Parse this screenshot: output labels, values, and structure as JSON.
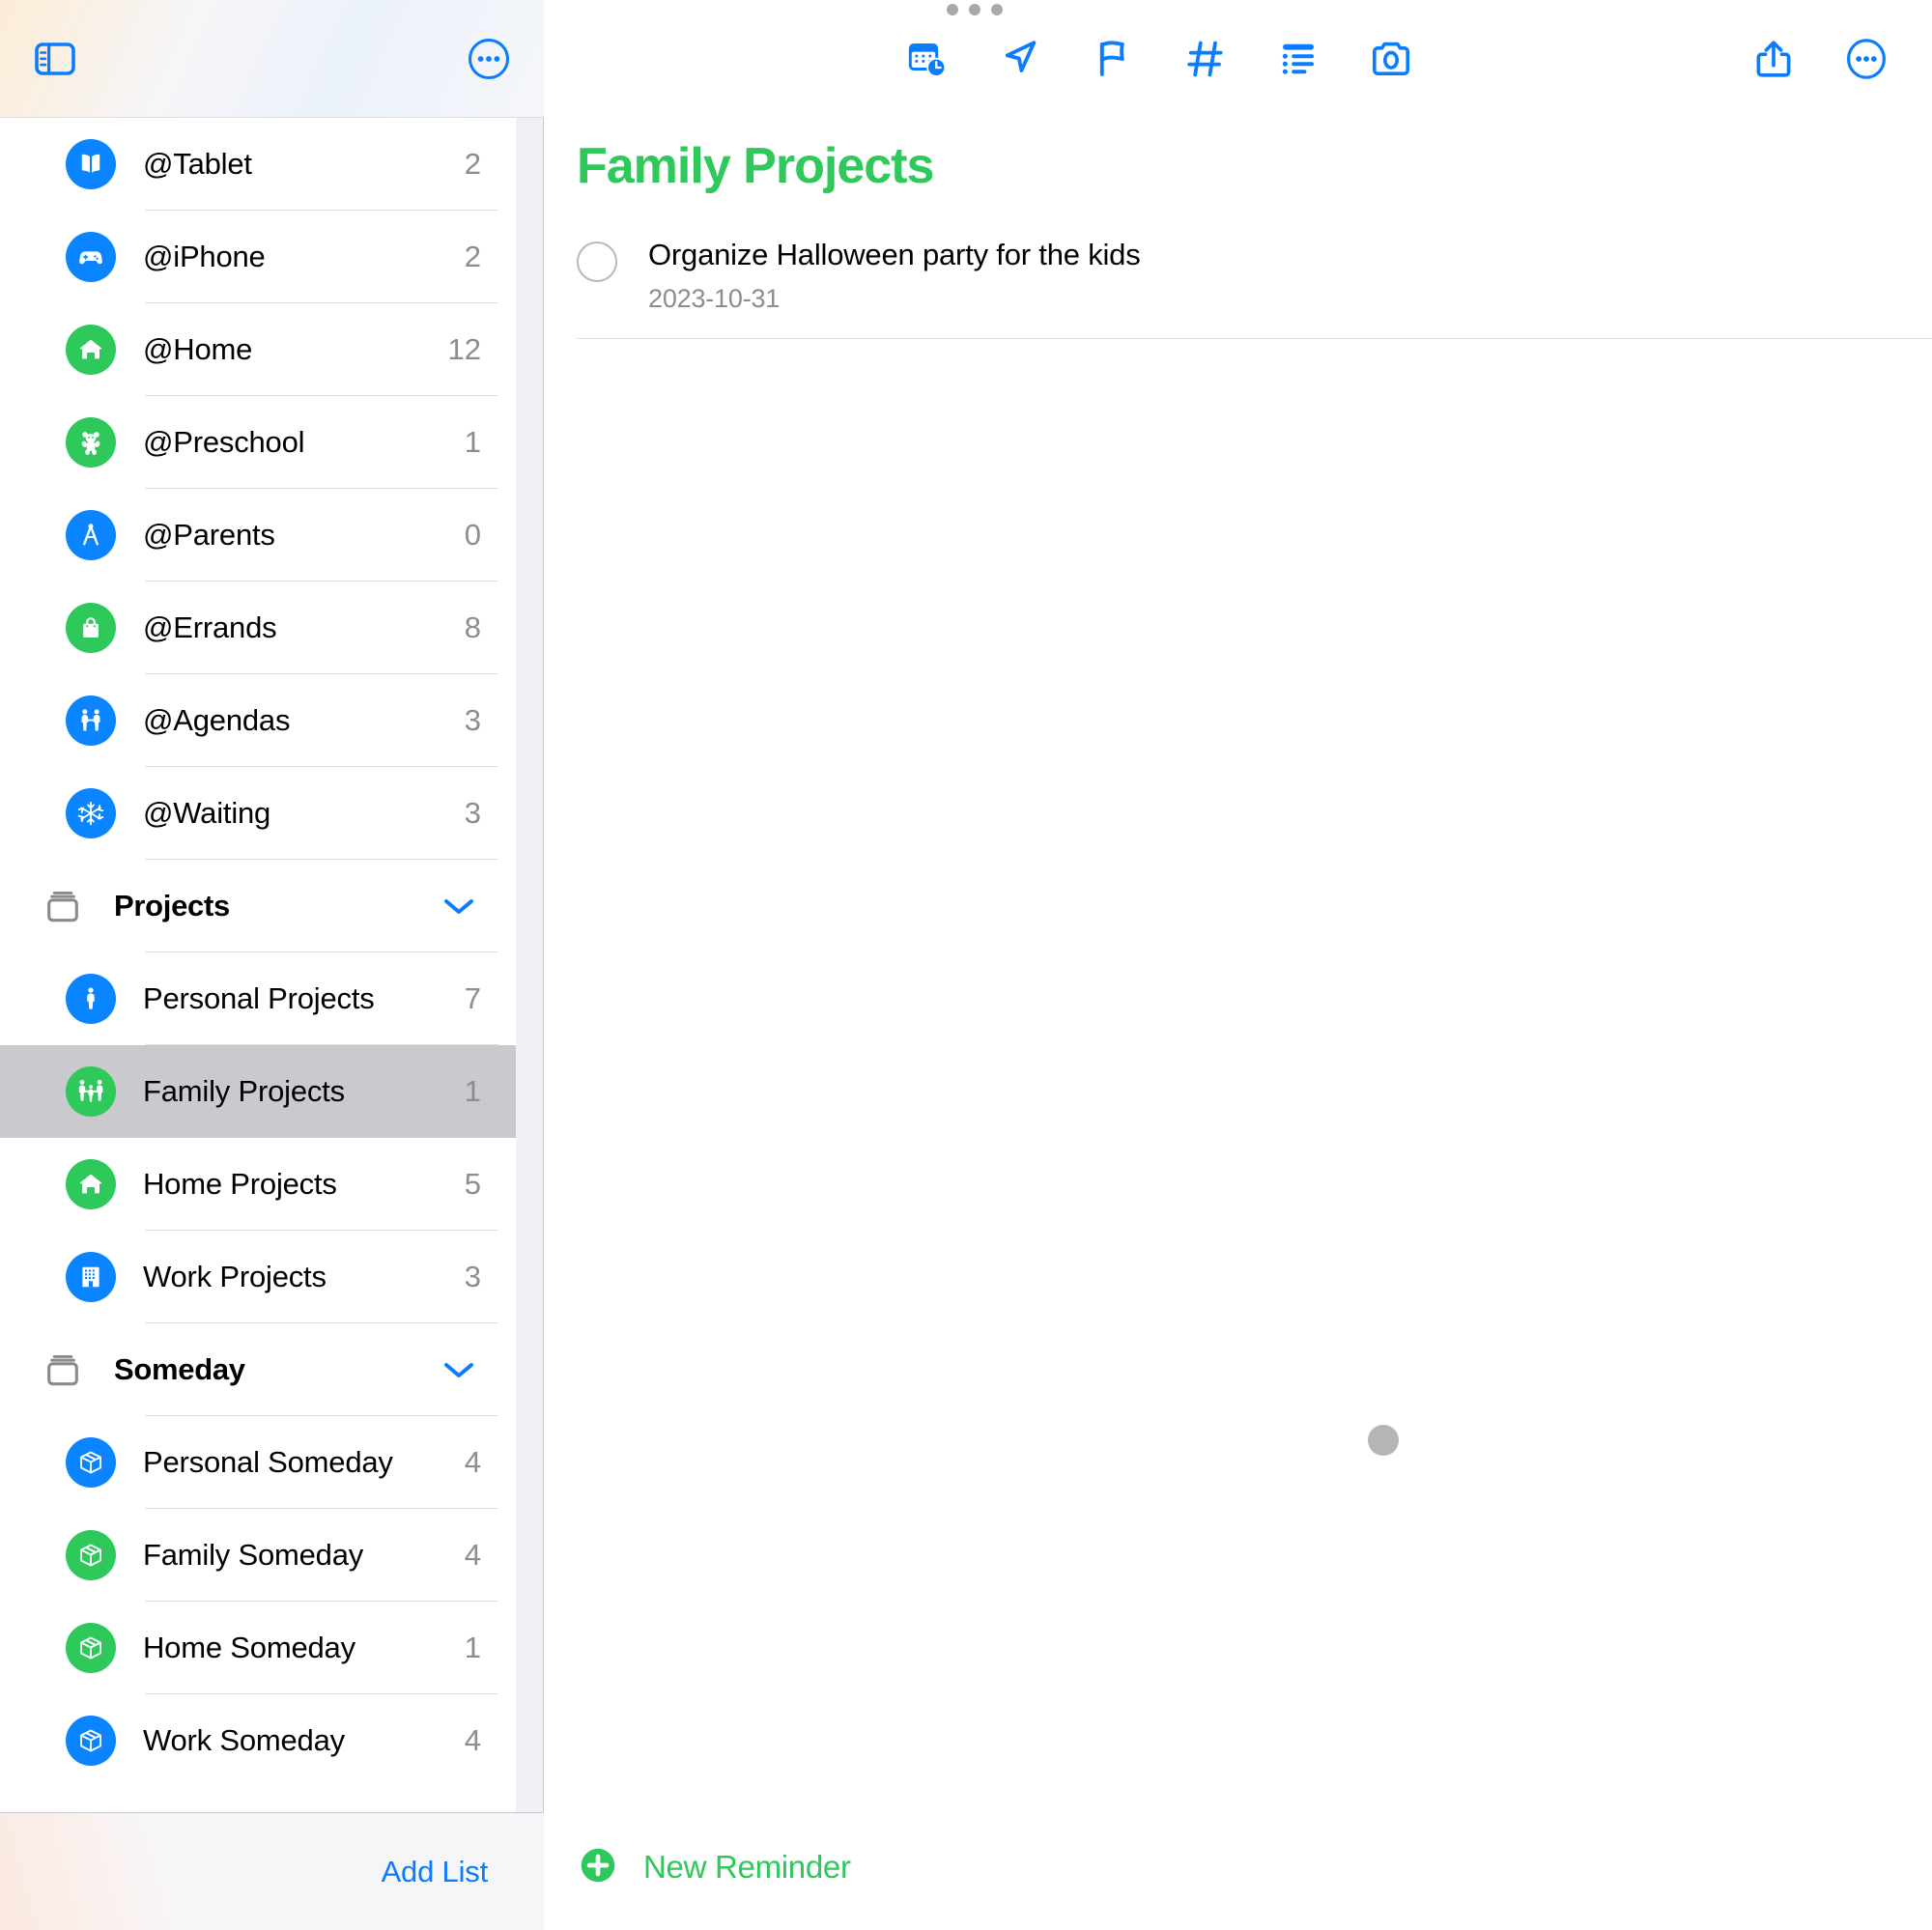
{
  "colors": {
    "accent_blue": "#0a7cff",
    "accent_green": "#2fc85a",
    "icon_blue": "#0a84ff",
    "icon_green": "#2fc85a",
    "selected_row": "#c9c9ce",
    "count_text": "#8c8c91"
  },
  "sidebar": {
    "header": {
      "toggle_icon": "sidebar-toggle-icon",
      "more_icon": "more-circle-icon"
    },
    "items": [
      {
        "type": "list",
        "label": "@Tablet",
        "count": "2",
        "icon": "book-icon",
        "color": "#0a84ff"
      },
      {
        "type": "list",
        "label": "@iPhone",
        "count": "2",
        "icon": "gamepad-icon",
        "color": "#0a84ff"
      },
      {
        "type": "list",
        "label": "@Home",
        "count": "12",
        "icon": "house-icon",
        "color": "#2fc85a"
      },
      {
        "type": "list",
        "label": "@Preschool",
        "count": "1",
        "icon": "teddy-bear-icon",
        "color": "#2fc85a"
      },
      {
        "type": "list",
        "label": "@Parents",
        "count": "0",
        "icon": "compass-icon",
        "color": "#0a84ff"
      },
      {
        "type": "list",
        "label": "@Errands",
        "count": "8",
        "icon": "shopping-bag-icon",
        "color": "#2fc85a"
      },
      {
        "type": "list",
        "label": "@Agendas",
        "count": "3",
        "icon": "two-people-icon",
        "color": "#0a84ff"
      },
      {
        "type": "list",
        "label": "@Waiting",
        "count": "3",
        "icon": "snowflake-icon",
        "color": "#0a84ff"
      },
      {
        "type": "group",
        "label": "Projects",
        "icon": "folder-stack-icon",
        "chevron": "chevron-down-icon"
      },
      {
        "type": "list",
        "label": "Personal Projects",
        "count": "7",
        "icon": "person-walking-icon",
        "color": "#0a84ff"
      },
      {
        "type": "list",
        "label": "Family Projects",
        "count": "1",
        "icon": "family-icon",
        "color": "#2fc85a",
        "selected": true
      },
      {
        "type": "list",
        "label": "Home Projects",
        "count": "5",
        "icon": "house-icon",
        "color": "#2fc85a"
      },
      {
        "type": "list",
        "label": "Work Projects",
        "count": "3",
        "icon": "office-building-icon",
        "color": "#0a84ff"
      },
      {
        "type": "group",
        "label": "Someday",
        "icon": "folder-stack-icon",
        "chevron": "chevron-down-icon"
      },
      {
        "type": "list",
        "label": "Personal Someday",
        "count": "4",
        "icon": "box-icon",
        "color": "#0a84ff"
      },
      {
        "type": "list",
        "label": "Family Someday",
        "count": "4",
        "icon": "box-icon",
        "color": "#2fc85a"
      },
      {
        "type": "list",
        "label": "Home Someday",
        "count": "1",
        "icon": "box-icon",
        "color": "#2fc85a"
      },
      {
        "type": "list",
        "label": "Work Someday",
        "count": "4",
        "icon": "box-icon",
        "color": "#0a84ff"
      }
    ],
    "footer": {
      "add_list_label": "Add List"
    }
  },
  "main": {
    "toolbar": {
      "left_buttons": [
        {
          "name": "calendar-clock-icon",
          "label": "Date & Time"
        },
        {
          "name": "location-arrow-icon",
          "label": "Location"
        },
        {
          "name": "flag-icon",
          "label": "Flag"
        },
        {
          "name": "hash-icon",
          "label": "Tag"
        },
        {
          "name": "list-bullet-icon",
          "label": "Subtasks"
        },
        {
          "name": "camera-icon",
          "label": "Add Photo"
        }
      ],
      "right_buttons": [
        {
          "name": "share-icon",
          "label": "Share"
        },
        {
          "name": "more-circle-icon",
          "label": "More"
        }
      ]
    },
    "title": "Family Projects",
    "reminders": [
      {
        "title": "Organize Halloween party for the kids",
        "date": "2023-10-31",
        "checked": false
      }
    ],
    "new_reminder_label": "New Reminder"
  }
}
